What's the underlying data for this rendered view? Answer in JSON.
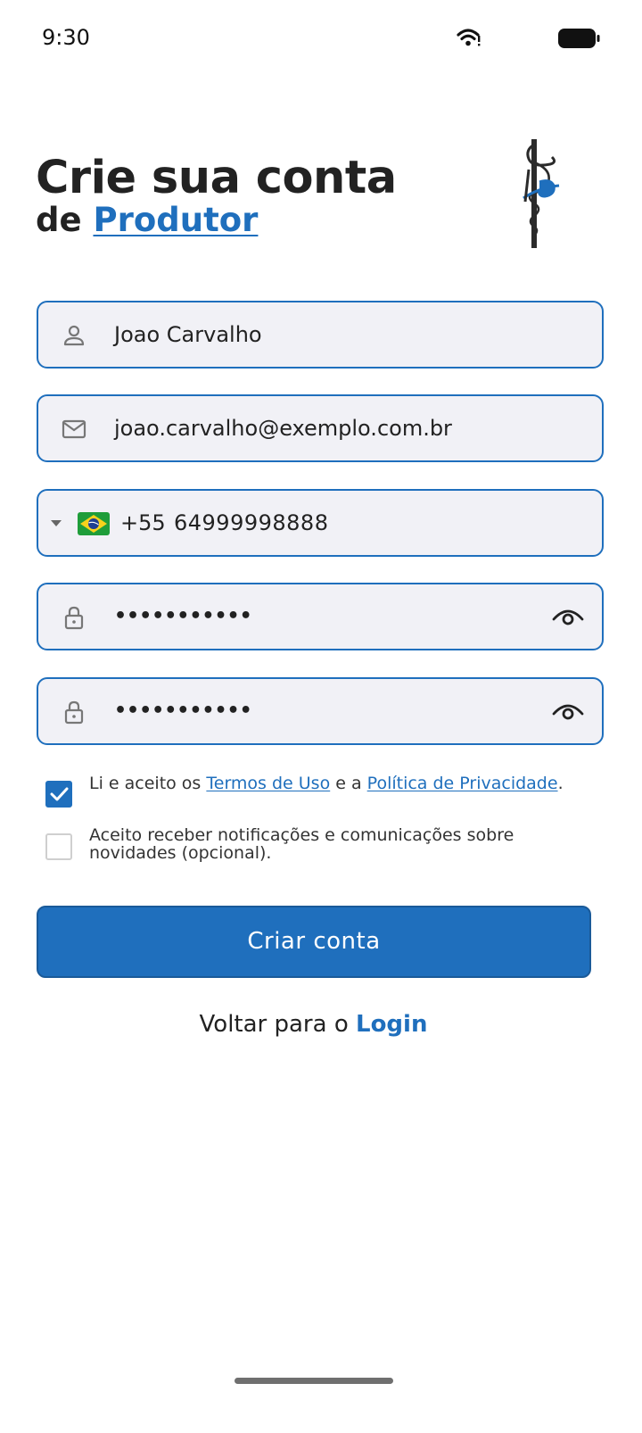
{
  "status_bar": {
    "time": "9:30"
  },
  "header": {
    "title_line1": "Crie sua conta",
    "title_prefix": "de ",
    "title_accent": "Produtor"
  },
  "form": {
    "name": {
      "value": "Joao Carvalho",
      "icon": "person-icon"
    },
    "email": {
      "value": "joao.carvalho@exemplo.com.br",
      "icon": "mail-icon"
    },
    "phone": {
      "country_code": "+55",
      "value": "64999998888",
      "flag": "brazil-flag"
    },
    "password": {
      "value": "•••••••••••",
      "icon": "lock-icon"
    },
    "password_confirm": {
      "value": "•••••••••••",
      "icon": "lock-icon"
    }
  },
  "consent": {
    "terms": {
      "checked": true,
      "text_before": "Li e aceito os ",
      "terms_link": "Termos de Uso",
      "text_middle": " e a ",
      "privacy_link": "Política de Privacidade",
      "text_after": "."
    },
    "notifications": {
      "checked": false,
      "text": "Aceito receber notificações e comunicações sobre novidades (opcional)."
    }
  },
  "actions": {
    "submit_label": "Criar conta",
    "back_prefix": "Voltar para o ",
    "back_link": "Login"
  },
  "colors": {
    "accent": "#1f6fbd",
    "field_background": "#f1f1f6"
  }
}
